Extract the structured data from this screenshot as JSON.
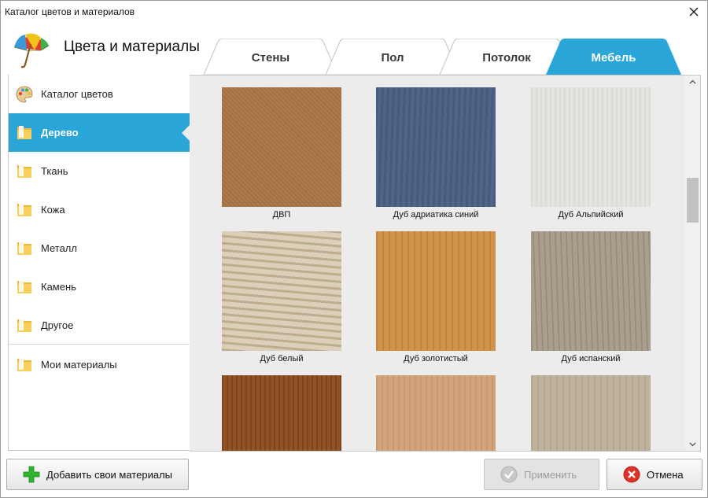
{
  "window": {
    "title": "Каталог цветов и материалов"
  },
  "header": {
    "title": "Цвета и материалы"
  },
  "tabs": [
    {
      "label": "Стены",
      "active": false
    },
    {
      "label": "Пол",
      "active": false
    },
    {
      "label": "Потолок",
      "active": false
    },
    {
      "label": "Мебель",
      "active": true
    }
  ],
  "sidebar": {
    "items": [
      {
        "label": "Каталог цветов",
        "icon": "palette-icon",
        "active": false
      },
      {
        "label": "Дерево",
        "icon": "folder-icon",
        "active": true
      },
      {
        "label": "Ткань",
        "icon": "folder-icon",
        "active": false
      },
      {
        "label": "Кожа",
        "icon": "folder-icon",
        "active": false
      },
      {
        "label": "Металл",
        "icon": "folder-icon",
        "active": false
      },
      {
        "label": "Камень",
        "icon": "folder-icon",
        "active": false
      },
      {
        "label": "Другое",
        "icon": "folder-icon",
        "active": false
      },
      {
        "label": "Мои материалы",
        "icon": "folder-icon",
        "active": false
      }
    ]
  },
  "materials": [
    {
      "label": "ДВП",
      "color": "#a97545"
    },
    {
      "label": "Дуб адриатика синий",
      "color": "#4a5f84"
    },
    {
      "label": "Дуб Альпийский",
      "color": "#e4e3dc"
    },
    {
      "label": "Дуб белый",
      "color": "#d6c7ae"
    },
    {
      "label": "Дуб золотистый",
      "color": "#cf8c3f"
    },
    {
      "label": "Дуб испанский",
      "color": "#a59886"
    },
    {
      "label": "",
      "color": "#8a4a1c"
    },
    {
      "label": "",
      "color": "#cf9f76"
    },
    {
      "label": "",
      "color": "#bcae98"
    }
  ],
  "footer": {
    "add_label": "Добавить свои материалы",
    "apply_label": "Применить",
    "cancel_label": "Отмена"
  },
  "colors": {
    "accent": "#2aa6d9",
    "content_bg": "#ececec"
  }
}
